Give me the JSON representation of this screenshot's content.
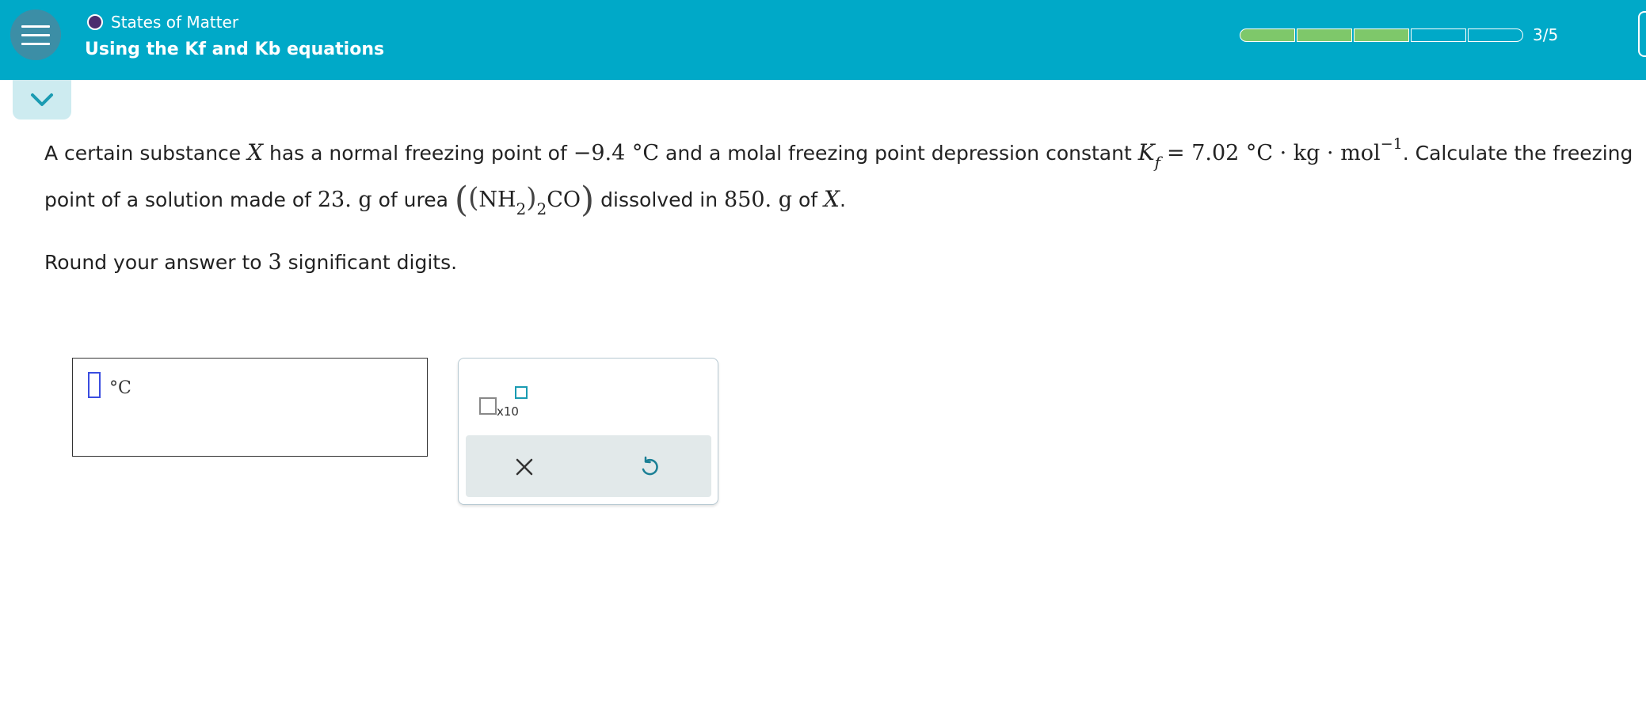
{
  "header": {
    "topic": "States of Matter",
    "lesson_title": "Using the Kf and Kb equations",
    "progress": {
      "completed": 3,
      "total": 5,
      "label": "3/5"
    }
  },
  "icons": {
    "menu": "hamburger-menu-icon",
    "collapse": "chevron-down-icon",
    "clear": "close-x-icon",
    "undo": "undo-icon"
  },
  "problem": {
    "t1": "A certain substance ",
    "var_x": "X",
    "t2": " has a normal freezing point of ",
    "fp": "−9.4 °C",
    "t3": " and a molal freezing point depression constant ",
    "k": "K",
    "k_sub": "f",
    "kf_value": "= 7.02 °C · kg · mol",
    "kf_exp": "−1",
    "t4": ". Calculate the freezing",
    "t5": "point of a solution made of ",
    "mass_solute": "23. g",
    "t6": " of urea ",
    "paren_open": "(",
    "paren_inner_open": "(",
    "nh": "NH",
    "nh_sub": "2",
    "paren_inner_close": ")",
    "outer_sub": "2",
    "co": "CO",
    "paren_close": ")",
    "t7": " dissolved in ",
    "mass_solvent": "850. g",
    "t8": " of ",
    "var_x2": "X",
    "t9": "."
  },
  "instructions": {
    "t1": "Round your answer to ",
    "digits": "3",
    "t2": " significant digits."
  },
  "answer": {
    "unit": "°C",
    "value": ""
  },
  "tools": {
    "x10_label": "x10"
  },
  "colors": {
    "header_bg": "#00a9c8",
    "progress_fill": "#7ec86a",
    "topic_dot": "#4b2d6e",
    "accent": "#1a9bb2"
  }
}
